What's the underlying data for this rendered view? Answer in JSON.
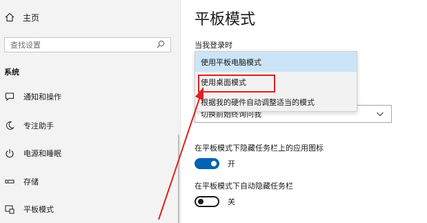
{
  "sidebar": {
    "home_label": "主页",
    "search_placeholder": "查找设置",
    "section_title": "系统",
    "items": [
      {
        "label": "通知和操作",
        "icon": "notification-icon"
      },
      {
        "label": "专注助手",
        "icon": "moon-icon"
      },
      {
        "label": "电源和睡眠",
        "icon": "power-icon"
      },
      {
        "label": "存储",
        "icon": "storage-icon"
      },
      {
        "label": "平板模式",
        "icon": "tablet-mode-icon"
      }
    ]
  },
  "main": {
    "title": "平板模式",
    "signin_label": "当我登录时",
    "dropdown_options": [
      "使用平板电脑模式",
      "使用桌面模式",
      "根据我的硬件自动调整适当的模式"
    ],
    "selected_option_index": 0,
    "select_partial_value": "切换前始终询问我",
    "hide_icons_label": "在平板模式下隐藏任务栏上的应用图标",
    "hide_icons_toggle": {
      "state": "开",
      "on": true
    },
    "autohide_label": "在平板模式下自动隐藏任务栏",
    "autohide_toggle": {
      "state": "关",
      "on": false
    }
  },
  "colors": {
    "accent": "#0063b1",
    "annotation": "#e02020",
    "selected_option_bg": "#cce4f7"
  }
}
